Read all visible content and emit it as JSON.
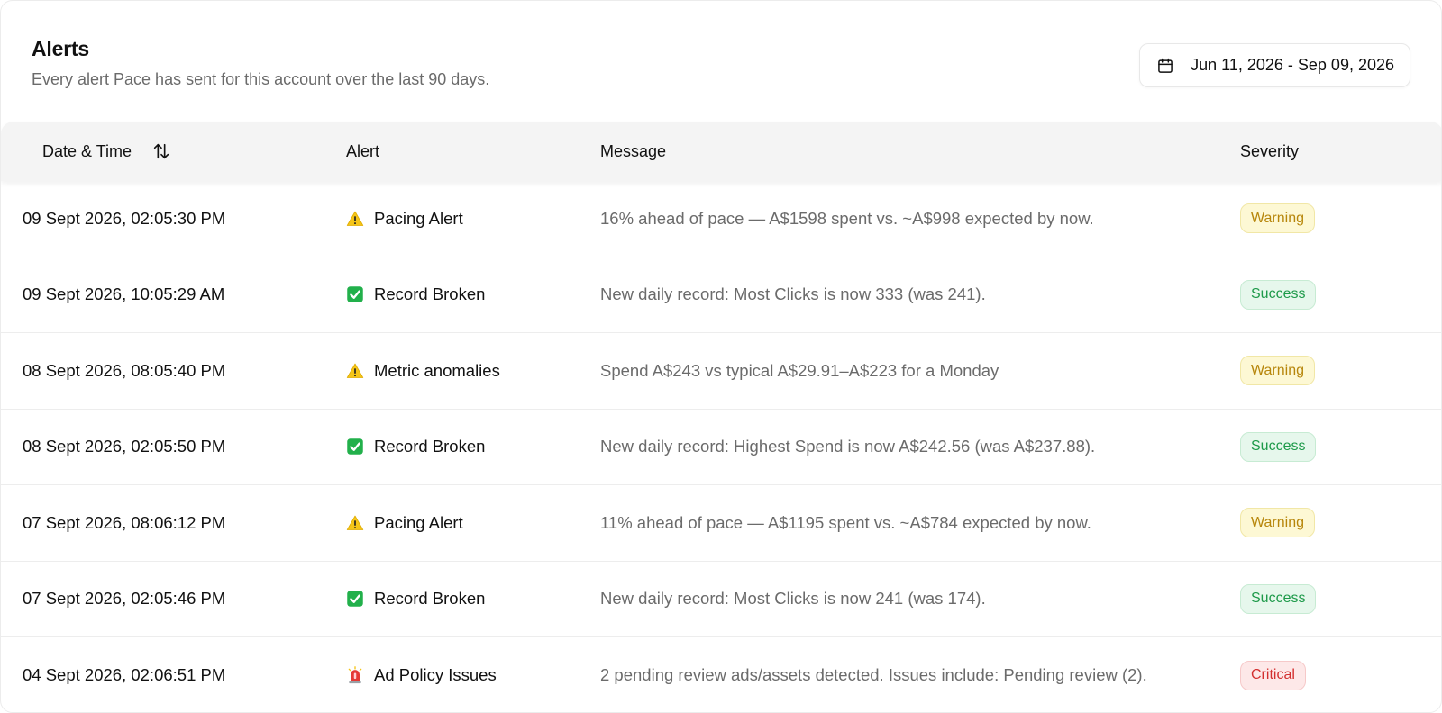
{
  "header": {
    "title": "Alerts",
    "subtitle": "Every alert Pace has sent for this account over the last 90 days."
  },
  "date_range": {
    "label": "Jun 11, 2026 - Sep 09, 2026",
    "icon": "calendar-icon"
  },
  "table": {
    "columns": {
      "date": "Date & Time",
      "alert": "Alert",
      "message": "Message",
      "severity": "Severity"
    },
    "rows": [
      {
        "date": "09 Sept 2026, 02:05:30 PM",
        "alert_icon": "warning-icon",
        "alert": "Pacing Alert",
        "message": "16% ahead of pace — A$1598 spent vs. ~A$998 expected by now.",
        "severity": "Warning"
      },
      {
        "date": "09 Sept 2026, 10:05:29 AM",
        "alert_icon": "check-icon",
        "alert": "Record Broken",
        "message": "New daily record: Most Clicks is now 333 (was 241).",
        "severity": "Success"
      },
      {
        "date": "08 Sept 2026, 08:05:40 PM",
        "alert_icon": "warning-icon",
        "alert": "Metric anomalies",
        "message": "Spend A$243 vs typical A$29.91–A$223 for a Monday",
        "severity": "Warning"
      },
      {
        "date": "08 Sept 2026, 02:05:50 PM",
        "alert_icon": "check-icon",
        "alert": "Record Broken",
        "message": "New daily record: Highest Spend is now A$242.56 (was A$237.88).",
        "severity": "Success"
      },
      {
        "date": "07 Sept 2026, 08:06:12 PM",
        "alert_icon": "warning-icon",
        "alert": "Pacing Alert",
        "message": "11% ahead of pace — A$1195 spent vs. ~A$784 expected by now.",
        "severity": "Warning"
      },
      {
        "date": "07 Sept 2026, 02:05:46 PM",
        "alert_icon": "check-icon",
        "alert": "Record Broken",
        "message": "New daily record: Most Clicks is now 241 (was 174).",
        "severity": "Success"
      },
      {
        "date": "04 Sept 2026, 02:06:51 PM",
        "alert_icon": "siren-icon",
        "alert": "Ad Policy Issues",
        "message": "2 pending review ads/assets detected. Issues include: Pending review (2).",
        "severity": "Critical"
      }
    ]
  },
  "colors": {
    "warning_bg": "#fdf8d4",
    "warning_text": "#b7860b",
    "success_bg": "#e6f7ec",
    "success_text": "#1e9a4a",
    "critical_bg": "#fde8e8",
    "critical_text": "#d32f2f"
  }
}
